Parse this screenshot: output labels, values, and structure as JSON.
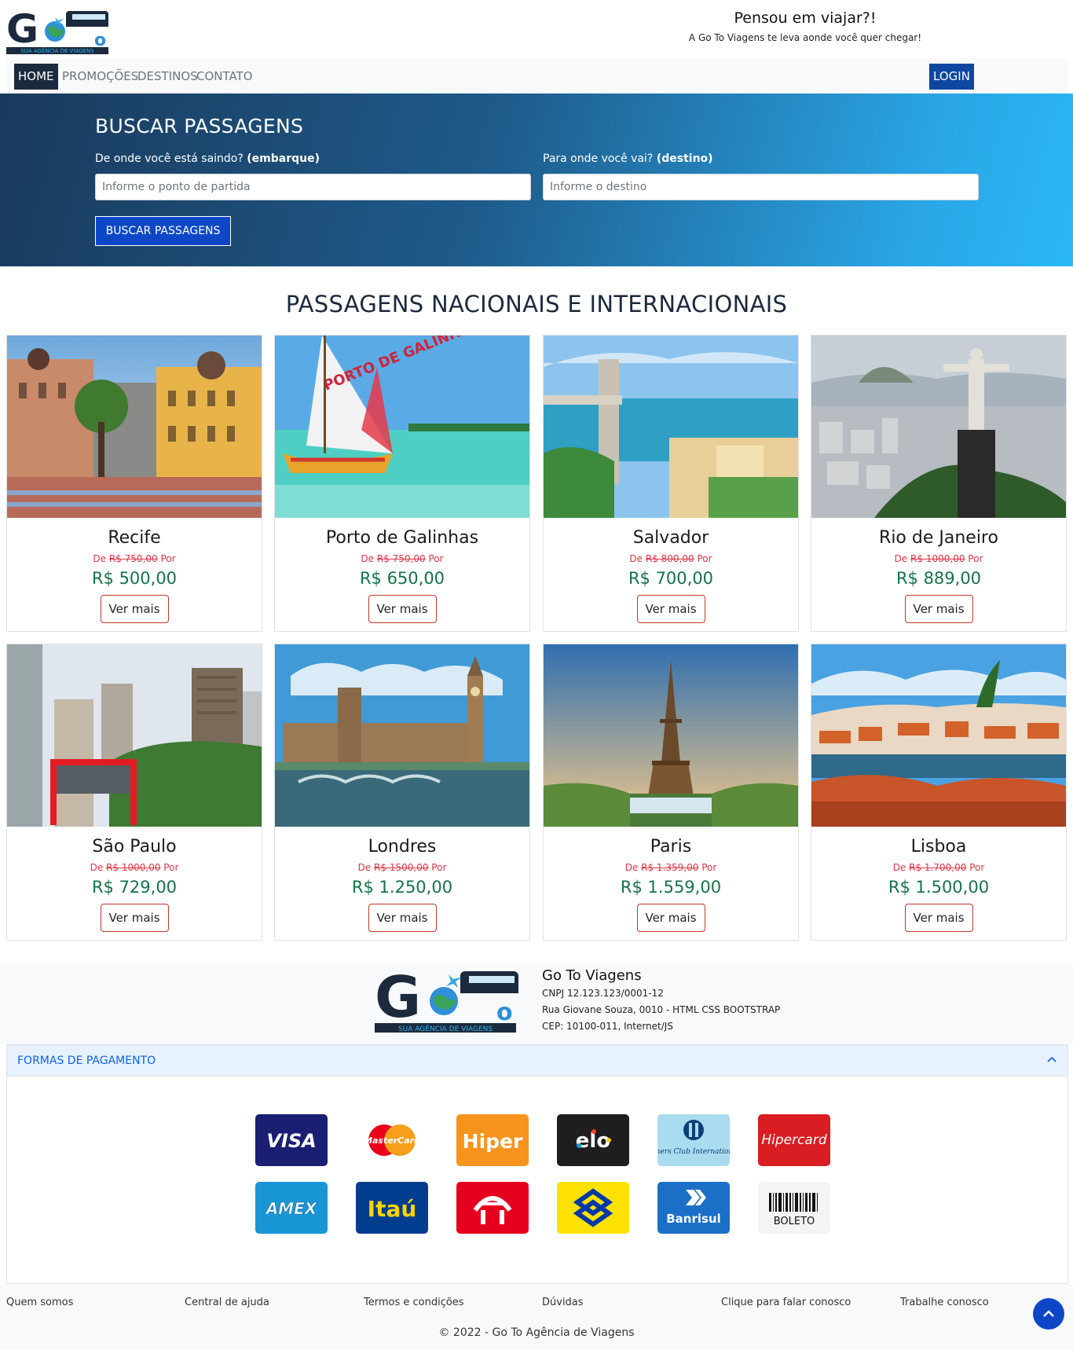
{
  "header": {
    "logo_text": "GoTo",
    "logo_tagline": "SUA AGÊNCIA DE VIAGENS",
    "tagline_title": "Pensou em viajar?!",
    "tagline_sub": "A Go To Viagens te leva aonde você quer chegar!"
  },
  "nav": {
    "items": [
      {
        "label": "HOME",
        "active": true
      },
      {
        "label": "PROMOÇÕES",
        "active": false
      },
      {
        "label": "DESTINOS",
        "active": false
      },
      {
        "label": "CONTATO",
        "active": false
      }
    ],
    "login": "LOGIN"
  },
  "search": {
    "title": "BUSCAR PASSAGENS",
    "origin_label": "De onde você está saindo?",
    "origin_label_bold": "(embarque)",
    "origin_placeholder": "Informe o ponto de partida",
    "dest_label": "Para onde você vai?",
    "dest_label_bold": "(destino)",
    "dest_placeholder": "Informe o destino",
    "button": "BUSCAR PASSAGENS"
  },
  "destinations": {
    "title": "PASSAGENS NACIONAIS E INTERNACIONAIS",
    "de": "De",
    "por": "Por",
    "button": "Ver mais",
    "cards": [
      {
        "name": "Recife",
        "old_price": "R$ 750,00",
        "price": "R$ 500,00",
        "scene": "recife"
      },
      {
        "name": "Porto de Galinhas",
        "old_price": "R$ 750,00",
        "price": "R$ 650,00",
        "scene": "galinhas",
        "sail_text": "PORTO DE GALINHAS"
      },
      {
        "name": "Salvador",
        "old_price": "R$ 800,00",
        "price": "R$ 700,00",
        "scene": "salvador"
      },
      {
        "name": "Rio de Janeiro",
        "old_price": "R$ 1000,00",
        "price": "R$ 889,00",
        "scene": "rio"
      },
      {
        "name": "São Paulo",
        "old_price": "R$ 1000,00",
        "price": "R$ 729,00",
        "scene": "saopaulo"
      },
      {
        "name": "Londres",
        "old_price": "R$ 1500,00",
        "price": "R$ 1.250,00",
        "scene": "londres"
      },
      {
        "name": "Paris",
        "old_price": "R$ 1.359,00",
        "price": "R$ 1.559,00",
        "scene": "paris"
      },
      {
        "name": "Lisboa",
        "old_price": "R$ 1.700,00",
        "price": "R$ 1.500,00",
        "scene": "lisboa"
      }
    ]
  },
  "company": {
    "name": "Go To Viagens",
    "cnpj": "CNPJ 12.123.123/0001-12",
    "address": "Rua Giovane Souza, 0010 - HTML CSS BOOTSTRAP",
    "cep": "CEP: 10100-011, Internet/JS"
  },
  "payments": {
    "title": "FORMAS DE PAGAMENTO",
    "methods": [
      {
        "name": "VISA",
        "bg": "#1a1f71",
        "fg": "#ffffff",
        "icon": "visa-logo"
      },
      {
        "name": "MasterCard",
        "bg": "#ffffff",
        "fg": "#ffffff",
        "icon": "mastercard-logo"
      },
      {
        "name": "Hiper",
        "bg": "#f7941d",
        "fg": "#ffffff",
        "icon": "hiper-logo"
      },
      {
        "name": "elo",
        "bg": "#1e1e1e",
        "fg": "#ffffff",
        "icon": "elo-logo"
      },
      {
        "name": "Diners Club International",
        "bg": "#a9dcef",
        "fg": "#0a3f7a",
        "icon": "diners-logo"
      },
      {
        "name": "Hipercard",
        "bg": "#d81e23",
        "fg": "#ffffff",
        "icon": "hipercard-logo"
      },
      {
        "name": "AMEX",
        "bg": "#1996d6",
        "fg": "#ffffff",
        "icon": "amex-logo"
      },
      {
        "name": "Itaú",
        "bg": "#003d8f",
        "fg": "#ffd400",
        "icon": "itau-logo"
      },
      {
        "name": "Bradesco",
        "bg": "#e6001f",
        "fg": "#ffffff",
        "icon": "bradesco-logo"
      },
      {
        "name": "Banco do Brasil",
        "bg": "#fde100",
        "fg": "#0038a8",
        "icon": "bancodobrasil-logo"
      },
      {
        "name": "Banrisul",
        "bg": "#1b6fc7",
        "fg": "#ffffff",
        "icon": "banrisul-logo"
      },
      {
        "name": "BOLETO",
        "bg": "#f4f4f4",
        "fg": "#111111",
        "icon": "boleto-logo"
      }
    ]
  },
  "footer": {
    "links": [
      "Quem somos",
      "Central de ajuda",
      "Termos e condições",
      "Dúvidas",
      "Clique para falar conosco",
      "Trabalhe conosco"
    ],
    "copyright": "© 2022 - Go To Agência de Viagens"
  },
  "colors": {
    "brand_dark": "#1b2a3d",
    "primary": "#0d47c8",
    "price_green": "#157347",
    "old_price_red": "#dc3545"
  }
}
